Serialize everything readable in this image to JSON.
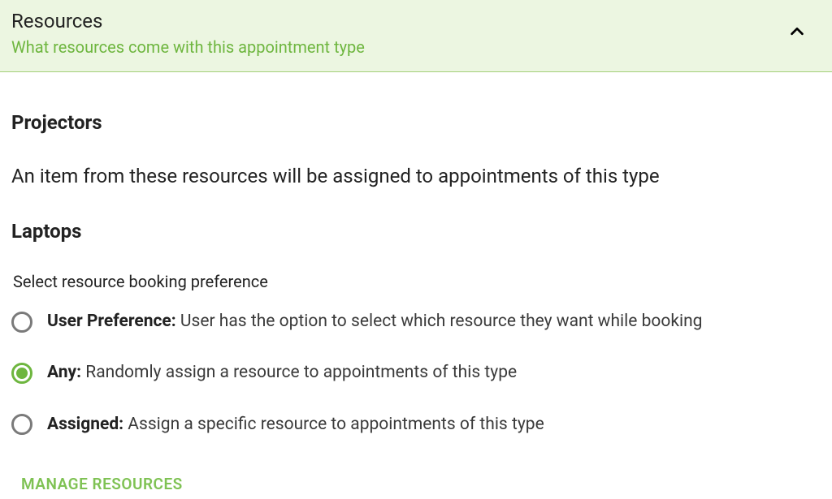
{
  "header": {
    "title": "Resources",
    "subtitle": "What resources come with this appointment type"
  },
  "section1": {
    "heading": "Projectors",
    "desc": "An item from these resources will be assigned to appointments of this type"
  },
  "section2": {
    "heading": "Laptops",
    "pref_label": "Select resource booking preference"
  },
  "options": [
    {
      "label": "User Preference:",
      "desc": " User has the option to select which resource they want while booking",
      "selected": false
    },
    {
      "label": "Any:",
      "desc": " Randomly assign a resource to appointments of this type",
      "selected": true
    },
    {
      "label": "Assigned:",
      "desc": " Assign a specific resource to appointments of this type",
      "selected": false
    }
  ],
  "manage": "MANAGE RESOURCES"
}
